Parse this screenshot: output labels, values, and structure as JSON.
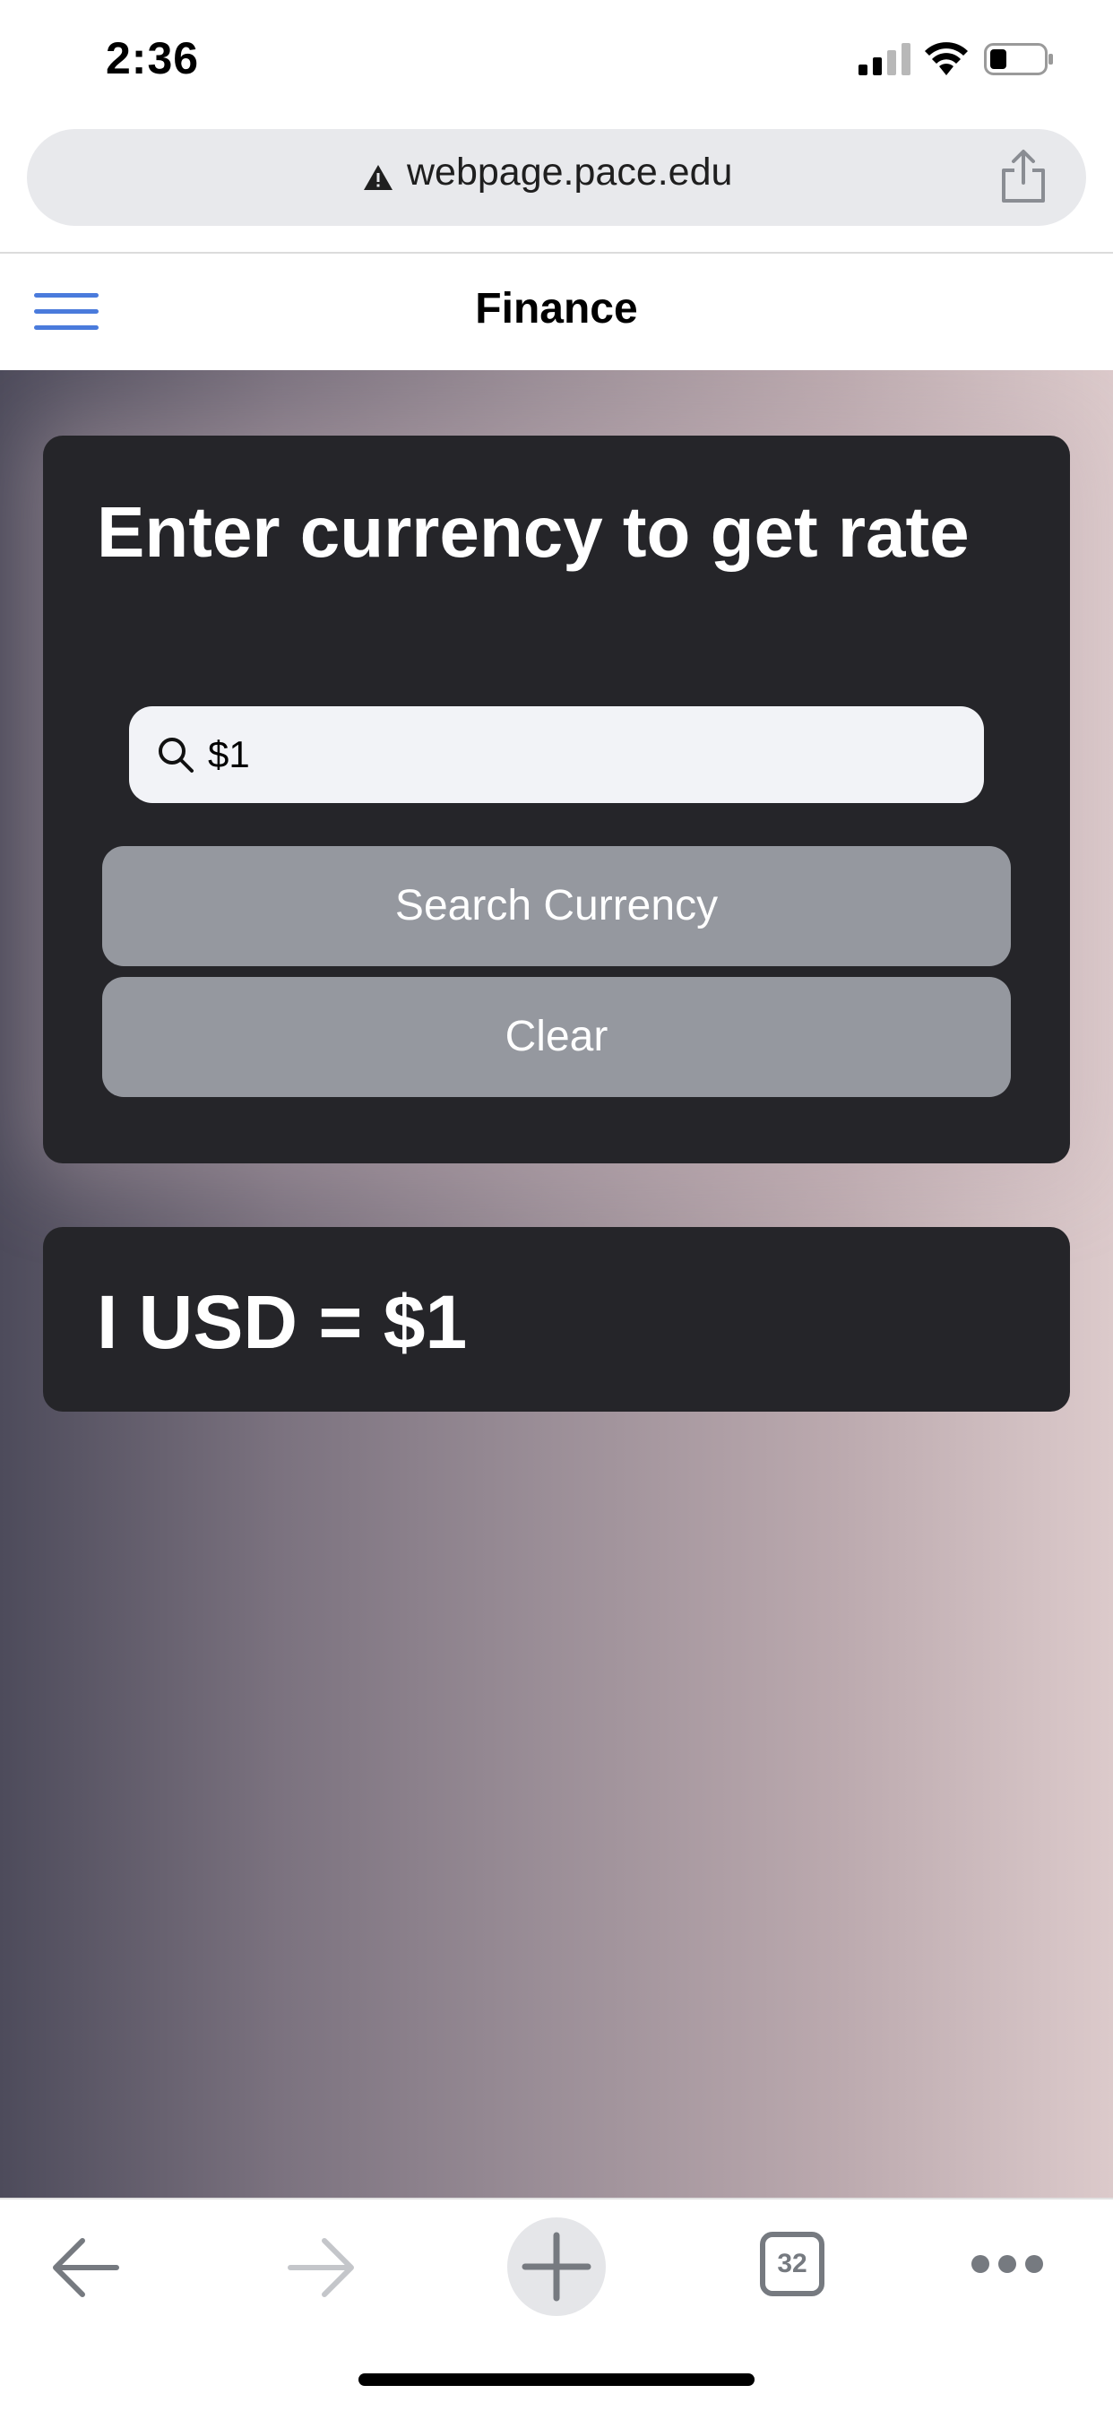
{
  "status_bar": {
    "time": "2:36"
  },
  "browser": {
    "url": "webpage.pace.edu",
    "tab_count": "32"
  },
  "header": {
    "title": "Finance"
  },
  "converter": {
    "heading": "Enter currency to get rate",
    "search_value": "$1",
    "search_button_label": "Search Currency",
    "clear_button_label": "Clear"
  },
  "result": {
    "text": "I USD = $1"
  },
  "colors": {
    "accent": "#4a7bdc",
    "card_bg": "#252529",
    "button_bg": "#95989f"
  }
}
